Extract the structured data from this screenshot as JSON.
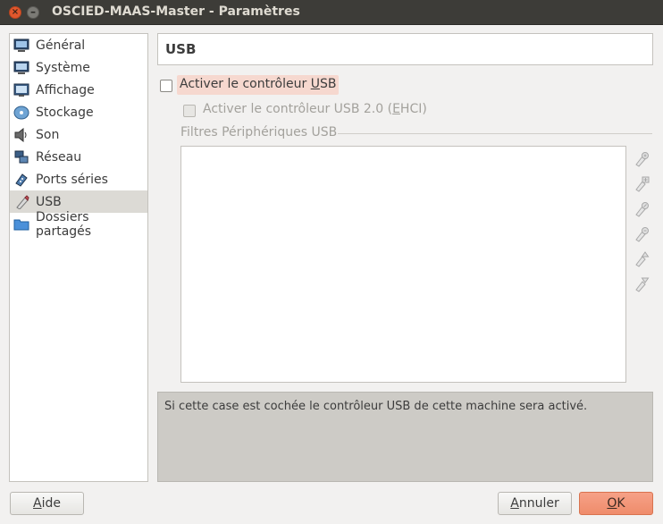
{
  "window": {
    "title": "OSCIED-MAAS-Master - Paramètres"
  },
  "sidebar": {
    "items": [
      {
        "label": "Général",
        "icon": "general-icon"
      },
      {
        "label": "Système",
        "icon": "system-icon"
      },
      {
        "label": "Affichage",
        "icon": "display-icon"
      },
      {
        "label": "Stockage",
        "icon": "storage-icon"
      },
      {
        "label": "Son",
        "icon": "audio-icon"
      },
      {
        "label": "Réseau",
        "icon": "network-icon"
      },
      {
        "label": "Ports séries",
        "icon": "serial-ports-icon"
      },
      {
        "label": "USB",
        "icon": "usb-icon",
        "selected": true
      },
      {
        "label": "Dossiers partagés",
        "icon": "shared-folders-icon"
      }
    ]
  },
  "page": {
    "title": "USB",
    "enable_usb_pre": "Activer le contrôleur ",
    "enable_usb_mn": "U",
    "enable_usb_post": "SB",
    "enable_usb_checked": false,
    "enable_usb2_pre": "Activer le contrôleur USB 2.0 (",
    "enable_usb2_mn": "E",
    "enable_usb2_post": "HCI)",
    "enable_usb2_checked": false,
    "filters_title": "Filtres Périphériques USB",
    "tools": [
      "usb-filter-add-icon",
      "usb-filter-add-from-device-icon",
      "usb-filter-edit-icon",
      "usb-filter-remove-icon",
      "usb-filter-move-up-icon",
      "usb-filter-move-down-icon"
    ],
    "info_text": "Si cette case est cochée le contrôleur USB de cette machine sera activé."
  },
  "footer": {
    "help_mn": "A",
    "help_rest": "ide",
    "cancel_mn": "A",
    "cancel_rest": "nnuler",
    "ok_mn": "O",
    "ok_rest": "K"
  }
}
